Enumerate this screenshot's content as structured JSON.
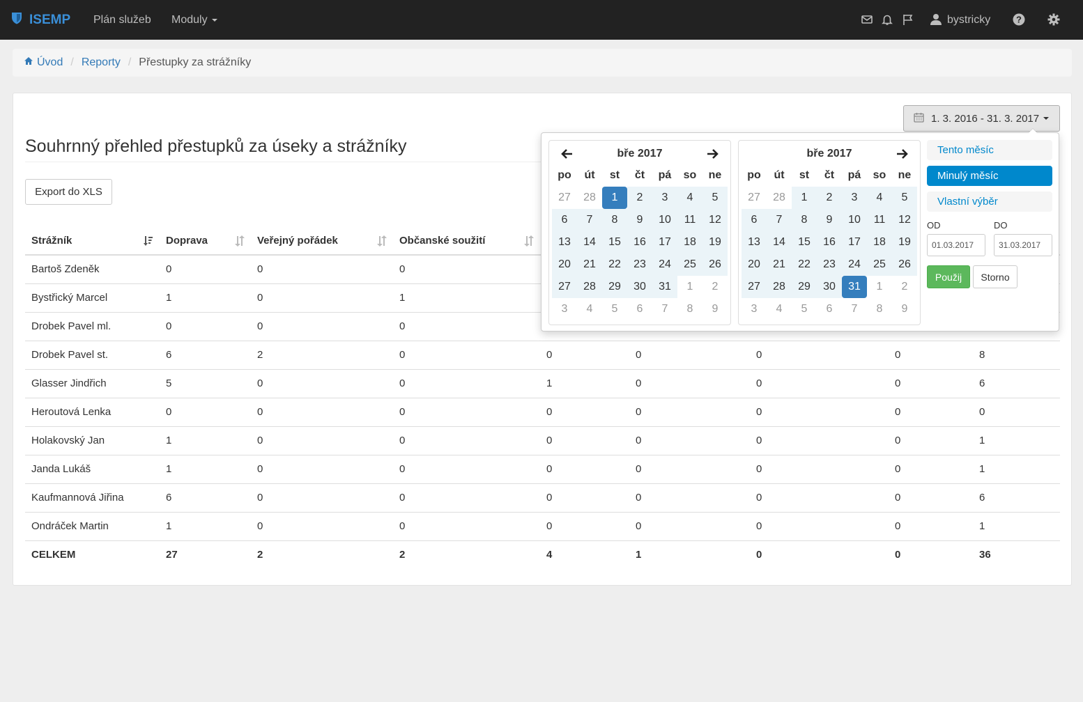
{
  "navbar": {
    "brand": "ISEMP",
    "items": [
      {
        "label": "Plán služeb"
      },
      {
        "label": "Moduly"
      }
    ],
    "user": "bystricky"
  },
  "breadcrumb": {
    "home": "Úvod",
    "reports": "Reporty",
    "current": "Přestupky za strážníky"
  },
  "page": {
    "title": "Souhrnný přehled přestupků za úseky a strážníky",
    "export_label": "Export do XLS",
    "date_range": "1. 3. 2016 - 31. 3. 2017"
  },
  "table": {
    "headers": [
      "Strážník",
      "Doprava",
      "Veřejný pořádek",
      "Občanské soužití"
    ],
    "rows": [
      [
        "Bartoš Zdeněk",
        "0",
        "0",
        "0",
        "",
        "",
        "",
        "",
        ""
      ],
      [
        "Bystřický Marcel",
        "1",
        "0",
        "1",
        "",
        "",
        "",
        "",
        ""
      ],
      [
        "Drobek Pavel ml.",
        "0",
        "0",
        "0",
        "",
        "",
        "",
        "",
        ""
      ],
      [
        "Drobek Pavel st.",
        "6",
        "2",
        "0",
        "0",
        "0",
        "0",
        "0",
        "8"
      ],
      [
        "Glasser Jindřich",
        "5",
        "0",
        "0",
        "1",
        "0",
        "0",
        "0",
        "6"
      ],
      [
        "Heroutová Lenka",
        "0",
        "0",
        "0",
        "0",
        "0",
        "0",
        "0",
        "0"
      ],
      [
        "Holakovský Jan",
        "1",
        "0",
        "0",
        "0",
        "0",
        "0",
        "0",
        "1"
      ],
      [
        "Janda Lukáš",
        "1",
        "0",
        "0",
        "0",
        "0",
        "0",
        "0",
        "1"
      ],
      [
        "Kaufmannová Jiřina",
        "6",
        "0",
        "0",
        "0",
        "0",
        "0",
        "0",
        "6"
      ],
      [
        "Ondráček Martin",
        "1",
        "0",
        "0",
        "0",
        "0",
        "0",
        "0",
        "1"
      ]
    ],
    "total": [
      "CELKEM",
      "27",
      "2",
      "2",
      "4",
      "1",
      "0",
      "0",
      "36"
    ]
  },
  "daterange": {
    "weekdays": [
      "po",
      "út",
      "st",
      "čt",
      "pá",
      "so",
      "ne"
    ],
    "left": {
      "month": "bře 2017",
      "days": [
        {
          "d": "27",
          "off": true
        },
        {
          "d": "28",
          "off": true
        },
        {
          "d": "1",
          "sel": true
        },
        {
          "d": "2",
          "inr": true
        },
        {
          "d": "3",
          "inr": true
        },
        {
          "d": "4",
          "inr": true
        },
        {
          "d": "5",
          "inr": true
        },
        {
          "d": "6",
          "inr": true
        },
        {
          "d": "7",
          "inr": true
        },
        {
          "d": "8",
          "inr": true
        },
        {
          "d": "9",
          "inr": true
        },
        {
          "d": "10",
          "inr": true
        },
        {
          "d": "11",
          "inr": true
        },
        {
          "d": "12",
          "inr": true
        },
        {
          "d": "13",
          "inr": true
        },
        {
          "d": "14",
          "inr": true
        },
        {
          "d": "15",
          "inr": true
        },
        {
          "d": "16",
          "inr": true
        },
        {
          "d": "17",
          "inr": true
        },
        {
          "d": "18",
          "inr": true
        },
        {
          "d": "19",
          "inr": true
        },
        {
          "d": "20",
          "inr": true
        },
        {
          "d": "21",
          "inr": true
        },
        {
          "d": "22",
          "inr": true
        },
        {
          "d": "23",
          "inr": true
        },
        {
          "d": "24",
          "inr": true
        },
        {
          "d": "25",
          "inr": true
        },
        {
          "d": "26",
          "inr": true
        },
        {
          "d": "27",
          "inr": true
        },
        {
          "d": "28",
          "inr": true
        },
        {
          "d": "29",
          "inr": true
        },
        {
          "d": "30",
          "inr": true
        },
        {
          "d": "31",
          "inr": true
        },
        {
          "d": "1",
          "off": true
        },
        {
          "d": "2",
          "off": true
        },
        {
          "d": "3",
          "off": true
        },
        {
          "d": "4",
          "off": true
        },
        {
          "d": "5",
          "off": true
        },
        {
          "d": "6",
          "off": true
        },
        {
          "d": "7",
          "off": true
        },
        {
          "d": "8",
          "off": true
        },
        {
          "d": "9",
          "off": true
        }
      ]
    },
    "right": {
      "month": "bře 2017",
      "days": [
        {
          "d": "27",
          "off": true
        },
        {
          "d": "28",
          "off": true
        },
        {
          "d": "1",
          "inr": true
        },
        {
          "d": "2",
          "inr": true
        },
        {
          "d": "3",
          "inr": true
        },
        {
          "d": "4",
          "inr": true
        },
        {
          "d": "5",
          "inr": true
        },
        {
          "d": "6",
          "inr": true
        },
        {
          "d": "7",
          "inr": true
        },
        {
          "d": "8",
          "inr": true
        },
        {
          "d": "9",
          "inr": true
        },
        {
          "d": "10",
          "inr": true
        },
        {
          "d": "11",
          "inr": true
        },
        {
          "d": "12",
          "inr": true
        },
        {
          "d": "13",
          "inr": true
        },
        {
          "d": "14",
          "inr": true
        },
        {
          "d": "15",
          "inr": true
        },
        {
          "d": "16",
          "inr": true
        },
        {
          "d": "17",
          "inr": true
        },
        {
          "d": "18",
          "inr": true
        },
        {
          "d": "19",
          "inr": true
        },
        {
          "d": "20",
          "inr": true
        },
        {
          "d": "21",
          "inr": true
        },
        {
          "d": "22",
          "inr": true
        },
        {
          "d": "23",
          "inr": true
        },
        {
          "d": "24",
          "inr": true
        },
        {
          "d": "25",
          "inr": true
        },
        {
          "d": "26",
          "inr": true
        },
        {
          "d": "27",
          "inr": true
        },
        {
          "d": "28",
          "inr": true
        },
        {
          "d": "29",
          "inr": true
        },
        {
          "d": "30",
          "inr": true
        },
        {
          "d": "31",
          "sel": true
        },
        {
          "d": "1",
          "off": true
        },
        {
          "d": "2",
          "off": true
        },
        {
          "d": "3",
          "off": true
        },
        {
          "d": "4",
          "off": true
        },
        {
          "d": "5",
          "off": true
        },
        {
          "d": "6",
          "off": true
        },
        {
          "d": "7",
          "off": true
        },
        {
          "d": "8",
          "off": true
        },
        {
          "d": "9",
          "off": true
        }
      ]
    },
    "ranges": [
      "Tento měsíc",
      "Minulý měsíc",
      "Vlastní výběr"
    ],
    "active_range": "Minulý měsíc",
    "from_label": "OD",
    "to_label": "DO",
    "from_value": "01.03.2017",
    "to_value": "31.03.2017",
    "apply_label": "Použij",
    "cancel_label": "Storno"
  },
  "colors": {
    "navbar": "#222222",
    "brand": "#3a8fd8",
    "link": "#337ab7",
    "selected_day": "#357ebd",
    "in_range": "#ebf4f8",
    "active_range": "#0088cc",
    "apply": "#5cb85c"
  }
}
